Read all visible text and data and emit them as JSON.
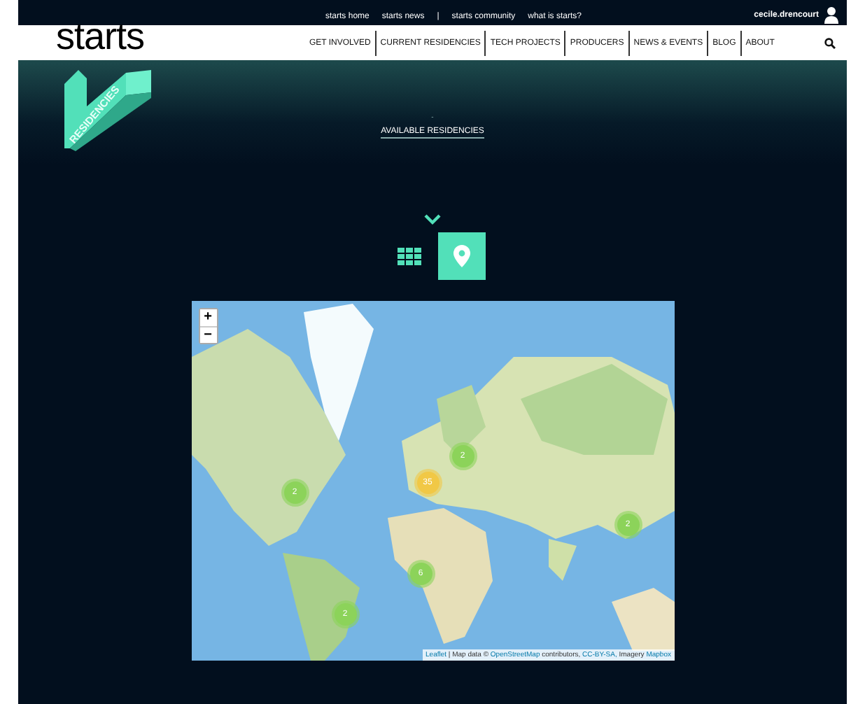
{
  "top_bar": {
    "links": [
      "starts home",
      "starts news",
      "|",
      "starts community",
      "what is starts?"
    ],
    "user": "cecile.drencourt"
  },
  "nav": {
    "logo": "starts",
    "items": [
      "GET INVOLVED",
      "CURRENT RESIDENCIES",
      "TECH PROJECTS",
      "PRODUCERS",
      "NEWS & EVENTS",
      "BLOG",
      "ABOUT"
    ]
  },
  "section_logo": {
    "text": "RESIDENCIES"
  },
  "header": {
    "mark": "-",
    "title": "AVAILABLE RESIDENCIES"
  },
  "view_toggle": [
    {
      "kind": "grid",
      "selected": false
    },
    {
      "kind": "map",
      "selected": true
    }
  ],
  "map": {
    "zoom_in": "+",
    "zoom_out": "−",
    "clusters": [
      {
        "count": "2",
        "color": "#8cd35a"
      },
      {
        "count": "35",
        "color": "#f1c846"
      },
      {
        "count": "2",
        "color": "#8cd35a"
      },
      {
        "count": "2",
        "color": "#8cd35a"
      },
      {
        "count": "6",
        "color": "#8cd35a"
      },
      {
        "count": "2",
        "color": "#8cd35a"
      }
    ],
    "attribution": [
      {
        "text": "Leaflet",
        "link": true
      },
      {
        "text": "| Map data ©",
        "link": false
      },
      {
        "text": "OpenStreetMap",
        "link": true
      },
      {
        "text": "contributors,",
        "link": false
      },
      {
        "text": "CC-BY-SA,",
        "link": true
      },
      {
        "text": "Imagery",
        "link": false
      },
      {
        "text": "Mapbox",
        "link": true
      }
    ]
  }
}
